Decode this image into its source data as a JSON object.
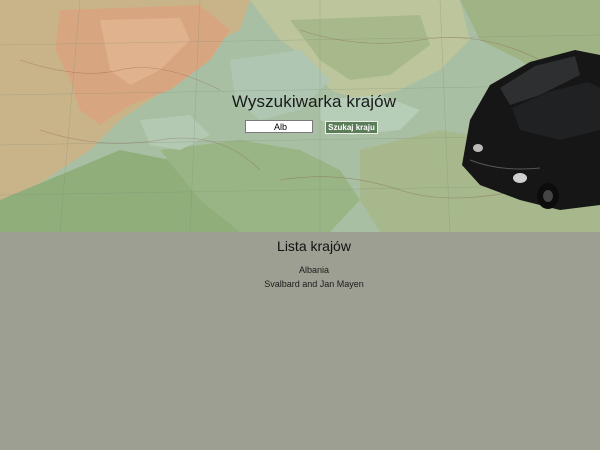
{
  "hero": {
    "title": "Wyszukiwarka krajów"
  },
  "search": {
    "value": "Alb",
    "button_label": "Szukaj kraju"
  },
  "list": {
    "title": "Lista krajów",
    "countries": [
      "Albania",
      "Svalbard and Jan Mayen"
    ]
  },
  "colors": {
    "page_background": "#9c9f92",
    "button_background": "#5b7c59"
  }
}
